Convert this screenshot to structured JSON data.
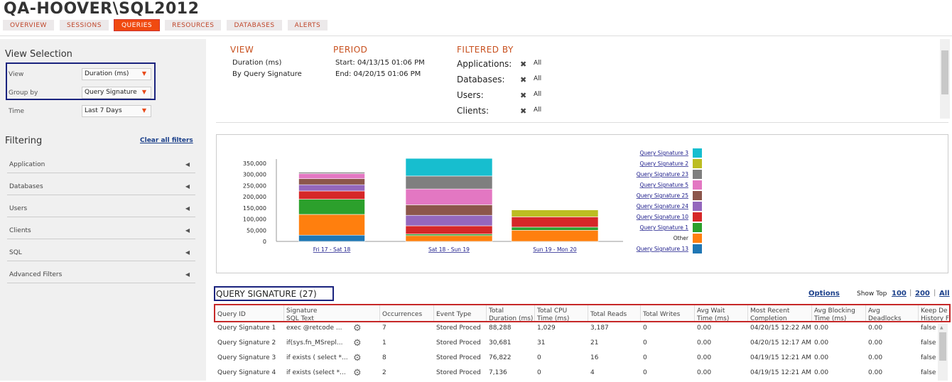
{
  "header": {
    "title": "QA-HOOVER\\SQL2012",
    "tabs": [
      {
        "label": "OVERVIEW"
      },
      {
        "label": "SESSIONS"
      },
      {
        "label": "QUERIES",
        "active": true
      },
      {
        "label": "RESOURCES"
      },
      {
        "label": "DATABASES"
      },
      {
        "label": "ALERTS"
      }
    ]
  },
  "sidebar": {
    "view_selection_title": "View Selection",
    "view_label": "View",
    "view_value": "Duration (ms)",
    "groupby_label": "Group by",
    "groupby_value": "Query Signature",
    "time_label": "Time",
    "time_value": "Last 7 Days",
    "filtering_title": "Filtering",
    "clear_filters": "Clear all filters",
    "filters": [
      "Application",
      "Databases",
      "Users",
      "Clients",
      "SQL",
      "Advanced Filters"
    ]
  },
  "summary": {
    "view_title": "VIEW",
    "view_lines": [
      "Duration (ms)",
      "By Query Signature"
    ],
    "period_title": "PERIOD",
    "period_lines": [
      "Start: 04/13/15 01:06 PM",
      "End: 04/20/15 01:06 PM"
    ],
    "filtered_title": "FILTERED BY",
    "filters": [
      {
        "label": "Applications:",
        "value": "All"
      },
      {
        "label": "Databases:",
        "value": "All"
      },
      {
        "label": "Users:",
        "value": "All"
      },
      {
        "label": "Clients:",
        "value": "All"
      }
    ]
  },
  "chart_data": {
    "type": "bar",
    "stacked": true,
    "categories": [
      "Fri 17 - Sat 18",
      "Sat 18 - Sun 19",
      "Sun 19 - Mon 20"
    ],
    "yticks": [
      "0",
      "50,000",
      "100,000",
      "150,000",
      "200,000",
      "250,000",
      "300,000",
      "350,000"
    ],
    "ylim": [
      0,
      350000
    ],
    "legend_position": "right",
    "series": [
      {
        "name": "Query Signature 13",
        "color": "#1f77b4",
        "values": [
          28000,
          0,
          0
        ]
      },
      {
        "name": "Other",
        "color": "#ff7f0e",
        "values": [
          93000,
          26000,
          50000
        ]
      },
      {
        "name": "Query Signature 1",
        "color": "#2ca02c",
        "values": [
          68000,
          7000,
          14000
        ]
      },
      {
        "name": "Query Signature 10",
        "color": "#d62728",
        "values": [
          37000,
          37000,
          46000
        ]
      },
      {
        "name": "Query Signature 24",
        "color": "#9467bd",
        "values": [
          28000,
          47000,
          0
        ]
      },
      {
        "name": "Query Signature 25",
        "color": "#8c564b",
        "values": [
          27000,
          47000,
          0
        ]
      },
      {
        "name": "Query Signature 5",
        "color": "#e377c2",
        "values": [
          23000,
          71000,
          0
        ]
      },
      {
        "name": "Query Signature 23",
        "color": "#7f7f7f",
        "values": [
          6000,
          58000,
          0
        ]
      },
      {
        "name": "Query Signature 2",
        "color": "#bcbd22",
        "values": [
          0,
          0,
          31000
        ]
      },
      {
        "name": "Query Signature 3",
        "color": "#17becf",
        "values": [
          0,
          79000,
          0
        ]
      }
    ]
  },
  "table": {
    "title": "QUERY SIGNATURE (27)",
    "options": "Options",
    "show_top": "Show Top",
    "top_options": [
      "100",
      "200",
      "All"
    ],
    "columns": [
      [
        "Query ID",
        ""
      ],
      [
        "Signature",
        "SQL Text"
      ],
      [
        "Occurrences",
        ""
      ],
      [
        "Event Type",
        ""
      ],
      [
        "Total",
        "Duration (ms)"
      ],
      [
        "Total CPU",
        "Time (ms)"
      ],
      [
        "Total Reads",
        ""
      ],
      [
        "Total Writes",
        ""
      ],
      [
        "Avg Wait",
        "Time (ms)"
      ],
      [
        "Most Recent",
        "Completion"
      ],
      [
        "Avg Blocking",
        "Time (ms)"
      ],
      [
        "Avg",
        "Deadlocks"
      ],
      [
        "Keep De",
        "History F"
      ]
    ],
    "rows": [
      [
        "Query Signature 1",
        "exec @retcode ...",
        "7",
        "Stored Proced",
        "88,288",
        "1,029",
        "3,187",
        "0",
        "0.00",
        "04/20/15 12:22 AM",
        "0.00",
        "0.00",
        "false"
      ],
      [
        "Query Signature 2",
        "if(sys.fn_MSrepl...",
        "1",
        "Stored Proced",
        "30,681",
        "31",
        "21",
        "0",
        "0.00",
        "04/20/15 12:17 AM",
        "0.00",
        "0.00",
        "false"
      ],
      [
        "Query Signature 3",
        "if exists ( select *...",
        "8",
        "Stored Proced",
        "76,822",
        "0",
        "16",
        "0",
        "0.00",
        "04/19/15 12:21 AM",
        "0.00",
        "0.00",
        "false"
      ],
      [
        "Query Signature 4",
        "if exists (select *...",
        "2",
        "Stored Proced",
        "7,136",
        "0",
        "4",
        "0",
        "0.00",
        "04/19/15 12:21 AM",
        "0.00",
        "0.00",
        "false"
      ]
    ]
  }
}
